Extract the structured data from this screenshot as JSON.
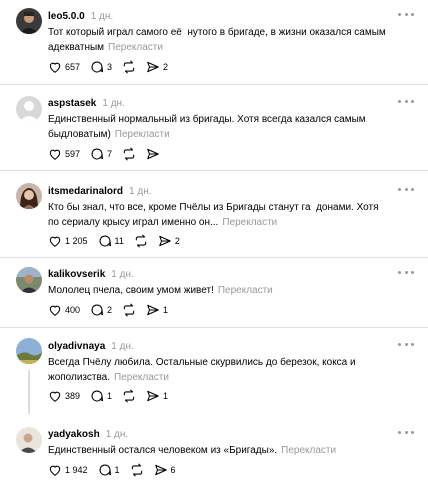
{
  "comments": [
    {
      "username": "leo5.0.0",
      "time": "1 дн.",
      "text": "Тот который играл самого её ﻿ ﻿нутого в бригаде, в жизни оказался самым адекватным",
      "translate": "Перекласти",
      "likes": "657",
      "replies": "3",
      "reposts": "",
      "shares": "2",
      "avatar": "man-in-dark-clothes"
    },
    {
      "username": "aspstasek",
      "time": "1 дн.",
      "text": "Единственный нормальный из бригады. Хотя всегда казался самым быдловатым)",
      "translate": "Перекласти",
      "likes": "597",
      "replies": "7",
      "reposts": "",
      "shares": "",
      "avatar": "default-gray-avatar"
    },
    {
      "username": "itsmedarinalord",
      "time": "1 дн.",
      "text": "Кто бы знал, что все, кроме Пчёлы из Бригады станут га﻿ ﻿ ﻿донами. Хотя по сериалу крысу играл именно он...",
      "translate": "Перекласти",
      "likes": "1 205",
      "replies": "11",
      "reposts": "",
      "shares": "2",
      "avatar": "woman-with-dark-hair"
    },
    {
      "username": "kalikovserik",
      "time": "1 дн.",
      "text": "Мололец пчела, своим умом живет!",
      "translate": "Перекласти",
      "likes": "400",
      "replies": "2",
      "reposts": "",
      "shares": "1",
      "avatar": "man-outdoors"
    },
    {
      "username": "olyadivnaya",
      "time": "1 дн.",
      "text": "Всегда Пчёлу любила. Остальные скурвились до березок, кокса и жополизства.",
      "translate": "Перекласти",
      "likes": "389",
      "replies": "1",
      "reposts": "",
      "shares": "1",
      "avatar": "landscape-with-sky"
    },
    {
      "username": "yadyakosh",
      "time": "1 дн.",
      "text": "Единственный остался человеком из «Бригады».",
      "translate": "Перекласти",
      "likes": "1 942",
      "replies": "1",
      "reposts": "",
      "shares": "6",
      "avatar": "person-in-light-room"
    }
  ],
  "colors": {
    "text": "#000000",
    "muted": "#999999",
    "divider": "#e0e0e0"
  }
}
